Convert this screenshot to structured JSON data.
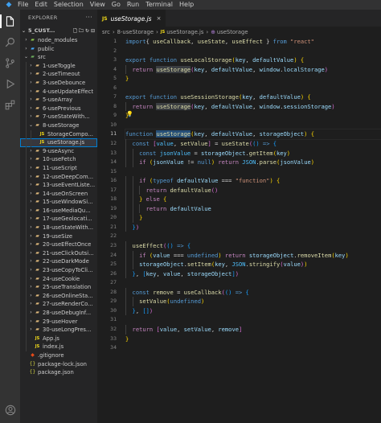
{
  "menu": [
    "File",
    "Edit",
    "Selection",
    "View",
    "Go",
    "Run",
    "Terminal",
    "Help"
  ],
  "sidebar": {
    "title": "EXPLORER",
    "more": "···",
    "section": "5_CUST...",
    "tree": [
      {
        "label": "node_modules",
        "icon": "nm",
        "chev": "›",
        "level": 1
      },
      {
        "label": "public",
        "icon": "pub",
        "chev": "›",
        "level": 1
      },
      {
        "label": "src",
        "icon": "src",
        "chev": "⌄",
        "level": 1
      },
      {
        "label": "1-useToggle",
        "icon": "folder",
        "chev": "›",
        "level": 2
      },
      {
        "label": "2-useTimeout",
        "icon": "folder",
        "chev": "›",
        "level": 2
      },
      {
        "label": "3-useDebounce",
        "icon": "folder",
        "chev": "›",
        "level": 2
      },
      {
        "label": "4-useUpdateEffect",
        "icon": "folder",
        "chev": "›",
        "level": 2
      },
      {
        "label": "5-useArray",
        "icon": "folder",
        "chev": "›",
        "level": 2
      },
      {
        "label": "6-usePrevious",
        "icon": "folder",
        "chev": "›",
        "level": 2
      },
      {
        "label": "7-useStateWith...",
        "icon": "folder",
        "chev": "›",
        "level": 2
      },
      {
        "label": "8-useStorage",
        "icon": "folder",
        "chev": "⌄",
        "level": 2
      },
      {
        "label": "StorageCompo...",
        "icon": "js",
        "chev": "",
        "level": 3
      },
      {
        "label": "useStorage.js",
        "icon": "js",
        "chev": "",
        "level": 3,
        "selected": true
      },
      {
        "label": "9-useAsync",
        "icon": "folder",
        "chev": "›",
        "level": 2
      },
      {
        "label": "10-useFetch",
        "icon": "folder",
        "chev": "›",
        "level": 2
      },
      {
        "label": "11-useScript",
        "icon": "folder",
        "chev": "›",
        "level": 2
      },
      {
        "label": "12-useDeepCom...",
        "icon": "folder",
        "chev": "›",
        "level": 2
      },
      {
        "label": "13-useEventListe...",
        "icon": "folder",
        "chev": "›",
        "level": 2
      },
      {
        "label": "14-useOnScreen",
        "icon": "folder",
        "chev": "›",
        "level": 2
      },
      {
        "label": "15-useWindowSi...",
        "icon": "folder",
        "chev": "›",
        "level": 2
      },
      {
        "label": "16-useMediaQu...",
        "icon": "folder",
        "chev": "›",
        "level": 2
      },
      {
        "label": "17-useGeolocati...",
        "icon": "folder",
        "chev": "›",
        "level": 2
      },
      {
        "label": "18-useStateWith...",
        "icon": "folder",
        "chev": "›",
        "level": 2
      },
      {
        "label": "19-useSize",
        "icon": "folder",
        "chev": "›",
        "level": 2
      },
      {
        "label": "20-useEffectOnce",
        "icon": "folder",
        "chev": "›",
        "level": 2
      },
      {
        "label": "21-useClickOutsi...",
        "icon": "folder",
        "chev": "›",
        "level": 2
      },
      {
        "label": "22-useDarkMode",
        "icon": "folder",
        "chev": "›",
        "level": 2
      },
      {
        "label": "23-useCopyToCli...",
        "icon": "folder",
        "chev": "›",
        "level": 2
      },
      {
        "label": "24-useCookie",
        "icon": "folder",
        "chev": "›",
        "level": 2
      },
      {
        "label": "25-useTranslation",
        "icon": "folder",
        "chev": "›",
        "level": 2
      },
      {
        "label": "26-useOnlineSta...",
        "icon": "folder",
        "chev": "›",
        "level": 2
      },
      {
        "label": "27-useRenderCo...",
        "icon": "folder",
        "chev": "›",
        "level": 2
      },
      {
        "label": "28-useDebugInf...",
        "icon": "folder",
        "chev": "›",
        "level": 2
      },
      {
        "label": "29-useHover",
        "icon": "folder",
        "chev": "›",
        "level": 2
      },
      {
        "label": "30-useLongPres...",
        "icon": "folder",
        "chev": "›",
        "level": 2
      },
      {
        "label": "App.js",
        "icon": "js",
        "chev": "",
        "level": 2
      },
      {
        "label": "index.js",
        "icon": "js",
        "chev": "",
        "level": 2
      },
      {
        "label": ".gitignore",
        "icon": "git",
        "chev": "",
        "level": 1
      },
      {
        "label": "package-lock.json",
        "icon": "json",
        "chev": "",
        "level": 1
      },
      {
        "label": "package.json",
        "icon": "json",
        "chev": "",
        "level": 1
      }
    ]
  },
  "tab": {
    "label": "useStorage.js",
    "badge": "JS",
    "close": "×"
  },
  "breadcrumb": {
    "p1": "src",
    "p2": "8-useStorage",
    "p3": "useStorage.js",
    "p4": "useStorage",
    "sep": "›",
    "badge": "JS",
    "fn_icon": "⊕"
  },
  "editor": {
    "current_line": 11,
    "line_numbers": [
      "1",
      "2",
      "3",
      "4",
      "5",
      "6",
      "7",
      "8",
      "9",
      "10",
      "11",
      "12",
      "13",
      "14",
      "15",
      "16",
      "17",
      "18",
      "19",
      "20",
      "21",
      "22",
      "23",
      "24",
      "25",
      "26",
      "27",
      "28",
      "29",
      "30",
      "31",
      "32",
      "33",
      "34"
    ],
    "lines": [
      [
        [
          "kw",
          "import"
        ],
        [
          "",
          "{ "
        ],
        [
          "fn-c",
          "useCallback"
        ],
        [
          "",
          ", "
        ],
        [
          "fn-c",
          "useState"
        ],
        [
          "",
          ", "
        ],
        [
          "fn-c",
          "useEffect"
        ],
        [
          "",
          " } "
        ],
        [
          "kw",
          "from"
        ],
        [
          "",
          " "
        ],
        [
          "str",
          "\"react\""
        ]
      ],
      [],
      [
        [
          "kw",
          "export"
        ],
        [
          "",
          " "
        ],
        [
          "kw",
          "function"
        ],
        [
          "",
          " "
        ],
        [
          "fn-c",
          "useLocalStorage"
        ],
        [
          "p1",
          "("
        ],
        [
          "var",
          "key"
        ],
        [
          "",
          ", "
        ],
        [
          "var",
          "defaultValue"
        ],
        [
          "p1",
          ")"
        ],
        [
          "",
          " "
        ],
        [
          "p1",
          "{"
        ]
      ],
      [
        [
          "",
          "  "
        ],
        [
          "ctl",
          "return"
        ],
        [
          "",
          " "
        ],
        [
          "fn-c hl",
          "useStorage"
        ],
        [
          "p2",
          "("
        ],
        [
          "var",
          "key"
        ],
        [
          "",
          ", "
        ],
        [
          "var",
          "defaultValue"
        ],
        [
          "",
          ", "
        ],
        [
          "var",
          "window"
        ],
        [
          "",
          "."
        ],
        [
          "var",
          "localStorage"
        ],
        [
          "p2",
          ")"
        ]
      ],
      [
        [
          "p1",
          "}"
        ]
      ],
      [],
      [
        [
          "kw",
          "export"
        ],
        [
          "",
          " "
        ],
        [
          "kw",
          "function"
        ],
        [
          "",
          " "
        ],
        [
          "fn-c",
          "useSessionStorage"
        ],
        [
          "p1",
          "("
        ],
        [
          "var",
          "key"
        ],
        [
          "",
          ", "
        ],
        [
          "var",
          "defaultValue"
        ],
        [
          "p1",
          ")"
        ],
        [
          "",
          " "
        ],
        [
          "p1",
          "{"
        ]
      ],
      [
        [
          "",
          "  "
        ],
        [
          "ctl",
          "return"
        ],
        [
          "",
          " "
        ],
        [
          "fn-c hl",
          "useStorage"
        ],
        [
          "p2",
          "("
        ],
        [
          "var",
          "key"
        ],
        [
          "",
          ", "
        ],
        [
          "var",
          "defaultValue"
        ],
        [
          "",
          ", "
        ],
        [
          "var",
          "window"
        ],
        [
          "",
          "."
        ],
        [
          "var",
          "sessionStorage"
        ],
        [
          "p2",
          ")"
        ]
      ],
      [
        [
          "p1",
          "}"
        ]
      ],
      [],
      [
        [
          "kw",
          "function"
        ],
        [
          "",
          " "
        ],
        [
          "fn-c hlw",
          "useStorage"
        ],
        [
          "p1",
          "("
        ],
        [
          "var",
          "key"
        ],
        [
          "",
          ", "
        ],
        [
          "var",
          "defaultValue"
        ],
        [
          "",
          ", "
        ],
        [
          "var",
          "storageObject"
        ],
        [
          "p1",
          ")"
        ],
        [
          "",
          " "
        ],
        [
          "p1",
          "{"
        ]
      ],
      [
        [
          "",
          "  "
        ],
        [
          "kw",
          "const"
        ],
        [
          "",
          " "
        ],
        [
          "p2",
          "["
        ],
        [
          "cst",
          "value"
        ],
        [
          "",
          ", "
        ],
        [
          "fn-c",
          "setValue"
        ],
        [
          "p2",
          "]"
        ],
        [
          "",
          " = "
        ],
        [
          "fn-c",
          "useState"
        ],
        [
          "p2",
          "("
        ],
        [
          "p3",
          "()"
        ],
        [
          "",
          " "
        ],
        [
          "kw",
          "=>"
        ],
        [
          "",
          " "
        ],
        [
          "p3",
          "{"
        ]
      ],
      [
        [
          "",
          "    "
        ],
        [
          "kw",
          "const"
        ],
        [
          "",
          " "
        ],
        [
          "cst",
          "jsonValue"
        ],
        [
          "",
          " = "
        ],
        [
          "var",
          "storageObject"
        ],
        [
          "",
          "."
        ],
        [
          "fn-c",
          "getItem"
        ],
        [
          "p1",
          "("
        ],
        [
          "var",
          "key"
        ],
        [
          "p1",
          ")"
        ]
      ],
      [
        [
          "",
          "    "
        ],
        [
          "ctl",
          "if"
        ],
        [
          "",
          " "
        ],
        [
          "p1",
          "("
        ],
        [
          "var",
          "jsonValue"
        ],
        [
          "",
          " != "
        ],
        [
          "kw",
          "null"
        ],
        [
          "p1",
          ")"
        ],
        [
          "",
          " "
        ],
        [
          "ctl",
          "return"
        ],
        [
          "",
          " "
        ],
        [
          "cst",
          "JSON"
        ],
        [
          "",
          "."
        ],
        [
          "fn-c",
          "parse"
        ],
        [
          "p1",
          "("
        ],
        [
          "var",
          "jsonValue"
        ],
        [
          "p1",
          ")"
        ]
      ],
      [],
      [
        [
          "",
          "    "
        ],
        [
          "ctl",
          "if"
        ],
        [
          "",
          " "
        ],
        [
          "p1",
          "("
        ],
        [
          "kw",
          "typeof"
        ],
        [
          "",
          " "
        ],
        [
          "var",
          "defaultValue"
        ],
        [
          "",
          " === "
        ],
        [
          "str",
          "\"function\""
        ],
        [
          "p1",
          ")"
        ],
        [
          "",
          " "
        ],
        [
          "p1",
          "{"
        ]
      ],
      [
        [
          "",
          "      "
        ],
        [
          "ctl",
          "return"
        ],
        [
          "",
          " "
        ],
        [
          "fn-c",
          "defaultValue"
        ],
        [
          "p2",
          "()"
        ]
      ],
      [
        [
          "",
          "    "
        ],
        [
          "p1",
          "}"
        ],
        [
          "",
          " "
        ],
        [
          "ctl",
          "else"
        ],
        [
          "",
          " "
        ],
        [
          "p1",
          "{"
        ]
      ],
      [
        [
          "",
          "      "
        ],
        [
          "ctl",
          "return"
        ],
        [
          "",
          " "
        ],
        [
          "var",
          "defaultValue"
        ]
      ],
      [
        [
          "",
          "    "
        ],
        [
          "p1",
          "}"
        ]
      ],
      [
        [
          "",
          "  "
        ],
        [
          "p3",
          "}"
        ],
        [
          "p2",
          ")"
        ]
      ],
      [],
      [
        [
          "",
          "  "
        ],
        [
          "fn-c",
          "useEffect"
        ],
        [
          "p2",
          "("
        ],
        [
          "p3",
          "()"
        ],
        [
          "",
          " "
        ],
        [
          "kw",
          "=>"
        ],
        [
          "",
          " "
        ],
        [
          "p3",
          "{"
        ]
      ],
      [
        [
          "",
          "    "
        ],
        [
          "ctl",
          "if"
        ],
        [
          "",
          " "
        ],
        [
          "p1",
          "("
        ],
        [
          "var",
          "value"
        ],
        [
          "",
          " === "
        ],
        [
          "kw",
          "undefined"
        ],
        [
          "p1",
          ")"
        ],
        [
          "",
          " "
        ],
        [
          "ctl",
          "return"
        ],
        [
          "",
          " "
        ],
        [
          "var",
          "storageObject"
        ],
        [
          "",
          "."
        ],
        [
          "fn-c",
          "removeItem"
        ],
        [
          "p1",
          "("
        ],
        [
          "var",
          "key"
        ],
        [
          "p1",
          ")"
        ]
      ],
      [
        [
          "",
          "    "
        ],
        [
          "var",
          "storageObject"
        ],
        [
          "",
          "."
        ],
        [
          "fn-c",
          "setItem"
        ],
        [
          "p1",
          "("
        ],
        [
          "var",
          "key"
        ],
        [
          "",
          ", "
        ],
        [
          "cst",
          "JSON"
        ],
        [
          "",
          "."
        ],
        [
          "fn-c",
          "stringify"
        ],
        [
          "p2",
          "("
        ],
        [
          "var",
          "value"
        ],
        [
          "p2",
          ")"
        ],
        [
          "p1",
          ")"
        ]
      ],
      [
        [
          "",
          "  "
        ],
        [
          "p3",
          "}"
        ],
        [
          "",
          ", "
        ],
        [
          "p3",
          "["
        ],
        [
          "var",
          "key"
        ],
        [
          "",
          ", "
        ],
        [
          "var",
          "value"
        ],
        [
          "",
          ", "
        ],
        [
          "var",
          "storageObject"
        ],
        [
          "p3",
          "]"
        ],
        [
          "p2",
          ")"
        ]
      ],
      [],
      [
        [
          "",
          "  "
        ],
        [
          "kw",
          "const"
        ],
        [
          "",
          " "
        ],
        [
          "fn-c",
          "remove"
        ],
        [
          "",
          " = "
        ],
        [
          "fn-c",
          "useCallback"
        ],
        [
          "p2",
          "("
        ],
        [
          "p3",
          "()"
        ],
        [
          "",
          " "
        ],
        [
          "kw",
          "=>"
        ],
        [
          "",
          " "
        ],
        [
          "p3",
          "{"
        ]
      ],
      [
        [
          "",
          "    "
        ],
        [
          "fn-c",
          "setValue"
        ],
        [
          "p1",
          "("
        ],
        [
          "kw",
          "undefined"
        ],
        [
          "p1",
          ")"
        ]
      ],
      [
        [
          "",
          "  "
        ],
        [
          "p3",
          "}"
        ],
        [
          "",
          ", "
        ],
        [
          "p3",
          "[]"
        ],
        [
          "p2",
          ")"
        ]
      ],
      [],
      [
        [
          "",
          "  "
        ],
        [
          "ctl",
          "return"
        ],
        [
          "",
          " "
        ],
        [
          "p2",
          "["
        ],
        [
          "var",
          "value"
        ],
        [
          "",
          ", "
        ],
        [
          "var",
          "setValue"
        ],
        [
          "",
          ", "
        ],
        [
          "var",
          "remove"
        ],
        [
          "p2",
          "]"
        ]
      ],
      [
        [
          "p1",
          "}"
        ]
      ],
      []
    ]
  }
}
